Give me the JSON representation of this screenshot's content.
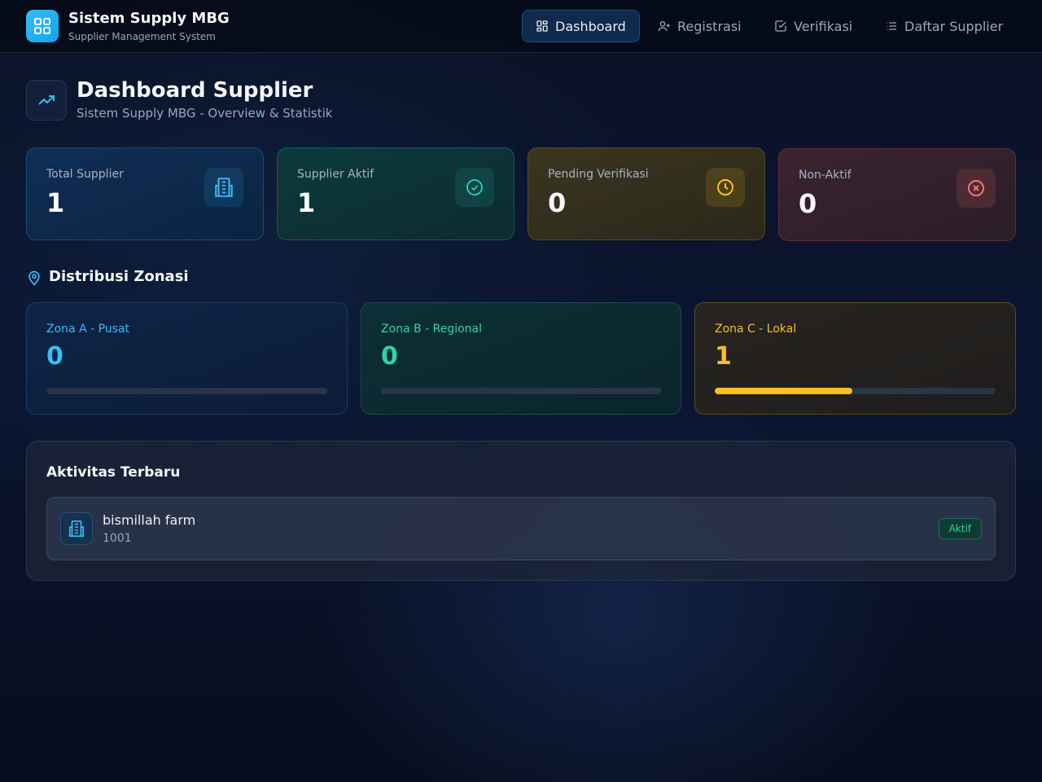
{
  "app": {
    "title": "Sistem Supply MBG",
    "subtitle": "Supplier Management System"
  },
  "nav": [
    {
      "label": "Dashboard",
      "icon": "grid-icon",
      "active": true
    },
    {
      "label": "Registrasi",
      "icon": "user-plus-icon",
      "active": false
    },
    {
      "label": "Verifikasi",
      "icon": "check-square-icon",
      "active": false
    },
    {
      "label": "Daftar Supplier",
      "icon": "list-icon",
      "active": false
    }
  ],
  "page": {
    "title": "Dashboard Supplier",
    "subtitle": "Sistem Supply MBG - Overview & Statistik"
  },
  "stats": [
    {
      "label": "Total Supplier",
      "value": "1",
      "icon": "building-icon",
      "color": "#38bdf8"
    },
    {
      "label": "Supplier Aktif",
      "value": "1",
      "icon": "check-circle-icon",
      "color": "#2dd4bf"
    },
    {
      "label": "Pending Verifikasi",
      "value": "0",
      "icon": "clock-icon",
      "color": "#fbbf24"
    },
    {
      "label": "Non-Aktif",
      "value": "0",
      "icon": "x-circle-icon",
      "color": "#f87171"
    }
  ],
  "zonasi": {
    "title": "Distribusi Zonasi",
    "zones": [
      {
        "label": "Zona A - Pusat",
        "value": "0",
        "fill_percent": 0,
        "color": "#38bdf8"
      },
      {
        "label": "Zona B - Regional",
        "value": "0",
        "fill_percent": 0,
        "color": "#2dd4a6"
      },
      {
        "label": "Zona C - Lokal",
        "value": "1",
        "fill_percent": 49,
        "color": "#fbbf24"
      }
    ]
  },
  "activity": {
    "title": "Aktivitas Terbaru",
    "items": [
      {
        "name": "bismillah farm",
        "id": "1001",
        "status": "Aktif"
      }
    ]
  }
}
